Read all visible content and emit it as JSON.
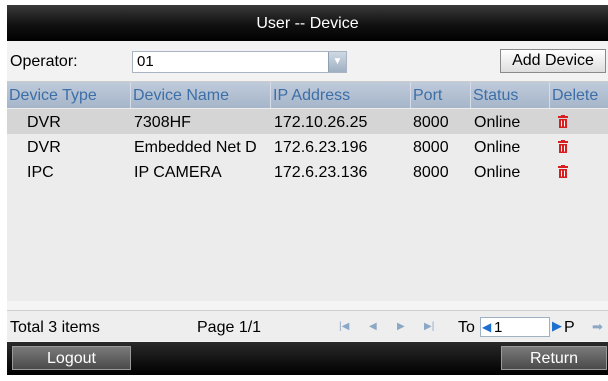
{
  "window": {
    "title": "User -- Device"
  },
  "operator": {
    "label": "Operator:",
    "value": "01"
  },
  "toolbar": {
    "add_device_label": "Add Device"
  },
  "table": {
    "headers": [
      "Device Type",
      "Device Name",
      "IP Address",
      "Port",
      "Status",
      "Delete"
    ],
    "rows": [
      {
        "type": "DVR",
        "name": "7308HF",
        "ip": "172.10.26.25",
        "port": "8000",
        "status": "Online",
        "delete_icon": "trash-icon"
      },
      {
        "type": "DVR",
        "name": "Embedded Net D",
        "ip": "172.6.23.196",
        "port": "8000",
        "status": "Online",
        "delete_icon": "trash-icon"
      },
      {
        "type": "IPC",
        "name": "IP CAMERA",
        "ip": "172.6.23.136",
        "port": "8000",
        "status": "Online",
        "delete_icon": "trash-icon"
      }
    ]
  },
  "footer": {
    "total": "Total 3 items",
    "page": "Page 1/1",
    "to_label": "To",
    "page_input": "1",
    "page_suffix": "P"
  },
  "bottom": {
    "logout_label": "Logout",
    "return_label": "Return"
  },
  "colors": {
    "header_text": "#3c6ea8",
    "delete_icon": "#d81e1e",
    "nav_arrow": "#8aa7c6"
  }
}
